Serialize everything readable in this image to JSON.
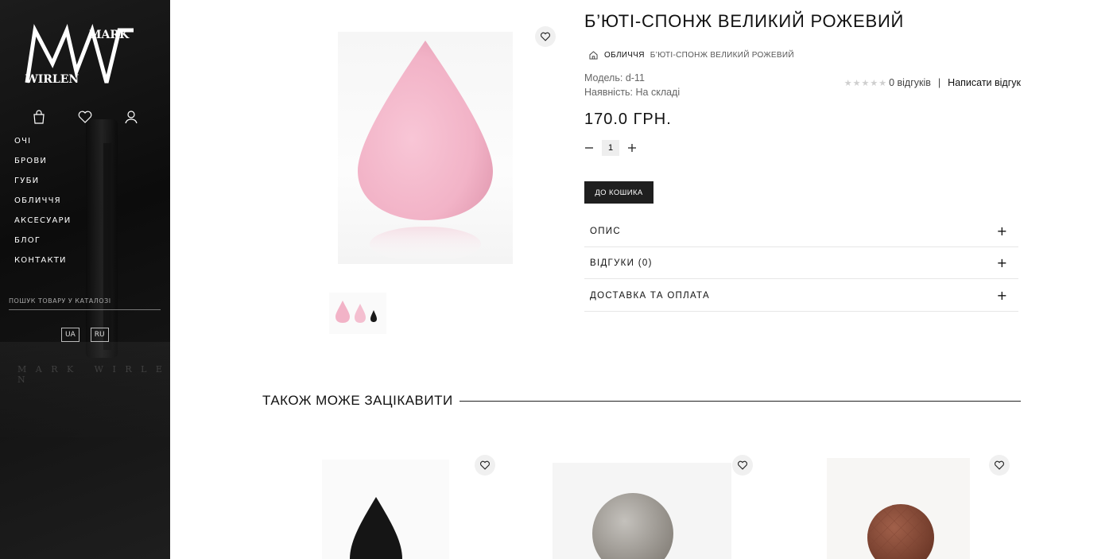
{
  "brand": {
    "logo_line1": "MARK",
    "logo_line2": "WIRLEN"
  },
  "sidebar": {
    "icons": [
      "bag-icon",
      "heart-icon",
      "user-icon"
    ],
    "nav": [
      "ОЧІ",
      "БРОВИ",
      "ГУБИ",
      "ОБЛИЧЧЯ",
      "АКСЕСУАРИ",
      "БЛОГ",
      "КОНТАКТИ"
    ],
    "search_placeholder": "ПОШУК ТОВАРУ У КАТАЛОЗІ",
    "languages": [
      "UA",
      "RU"
    ]
  },
  "product": {
    "title": "Б’ЮТІ-СПОНЖ ВЕЛИКИЙ РОЖЕВИЙ",
    "breadcrumb": {
      "category": "ОБЛИЧЧЯ",
      "current": "Б’ЮТІ-СПОНЖ ВЕЛИКИЙ РОЖЕВИЙ"
    },
    "model": "Модель: d-11",
    "availability": "Наявність: На складі",
    "rating": {
      "stars_filled": 0,
      "stars_total": 5,
      "reviews_text": "0 відгуків",
      "write_review": "Написати відгук"
    },
    "price": "170.0 ГРН.",
    "quantity": "1",
    "add_to_cart": "ДО КОШИКА",
    "accordion": [
      "ОПИС",
      "ВІДГУКИ (0)",
      "ДОСТАВКА ТА ОПЛАТА"
    ]
  },
  "related": {
    "title": "ТАКОЖ МОЖЕ ЗАЦІКАВИТИ",
    "items": [
      {
        "image": "black-sponge"
      },
      {
        "image": "silver-eyeshadow"
      },
      {
        "image": "brown-eyeshadow"
      }
    ]
  },
  "colors": {
    "sidebar_bg": "#111111",
    "sponge_pink": "#f3b9cc",
    "button_dark": "#1f1f1f"
  }
}
